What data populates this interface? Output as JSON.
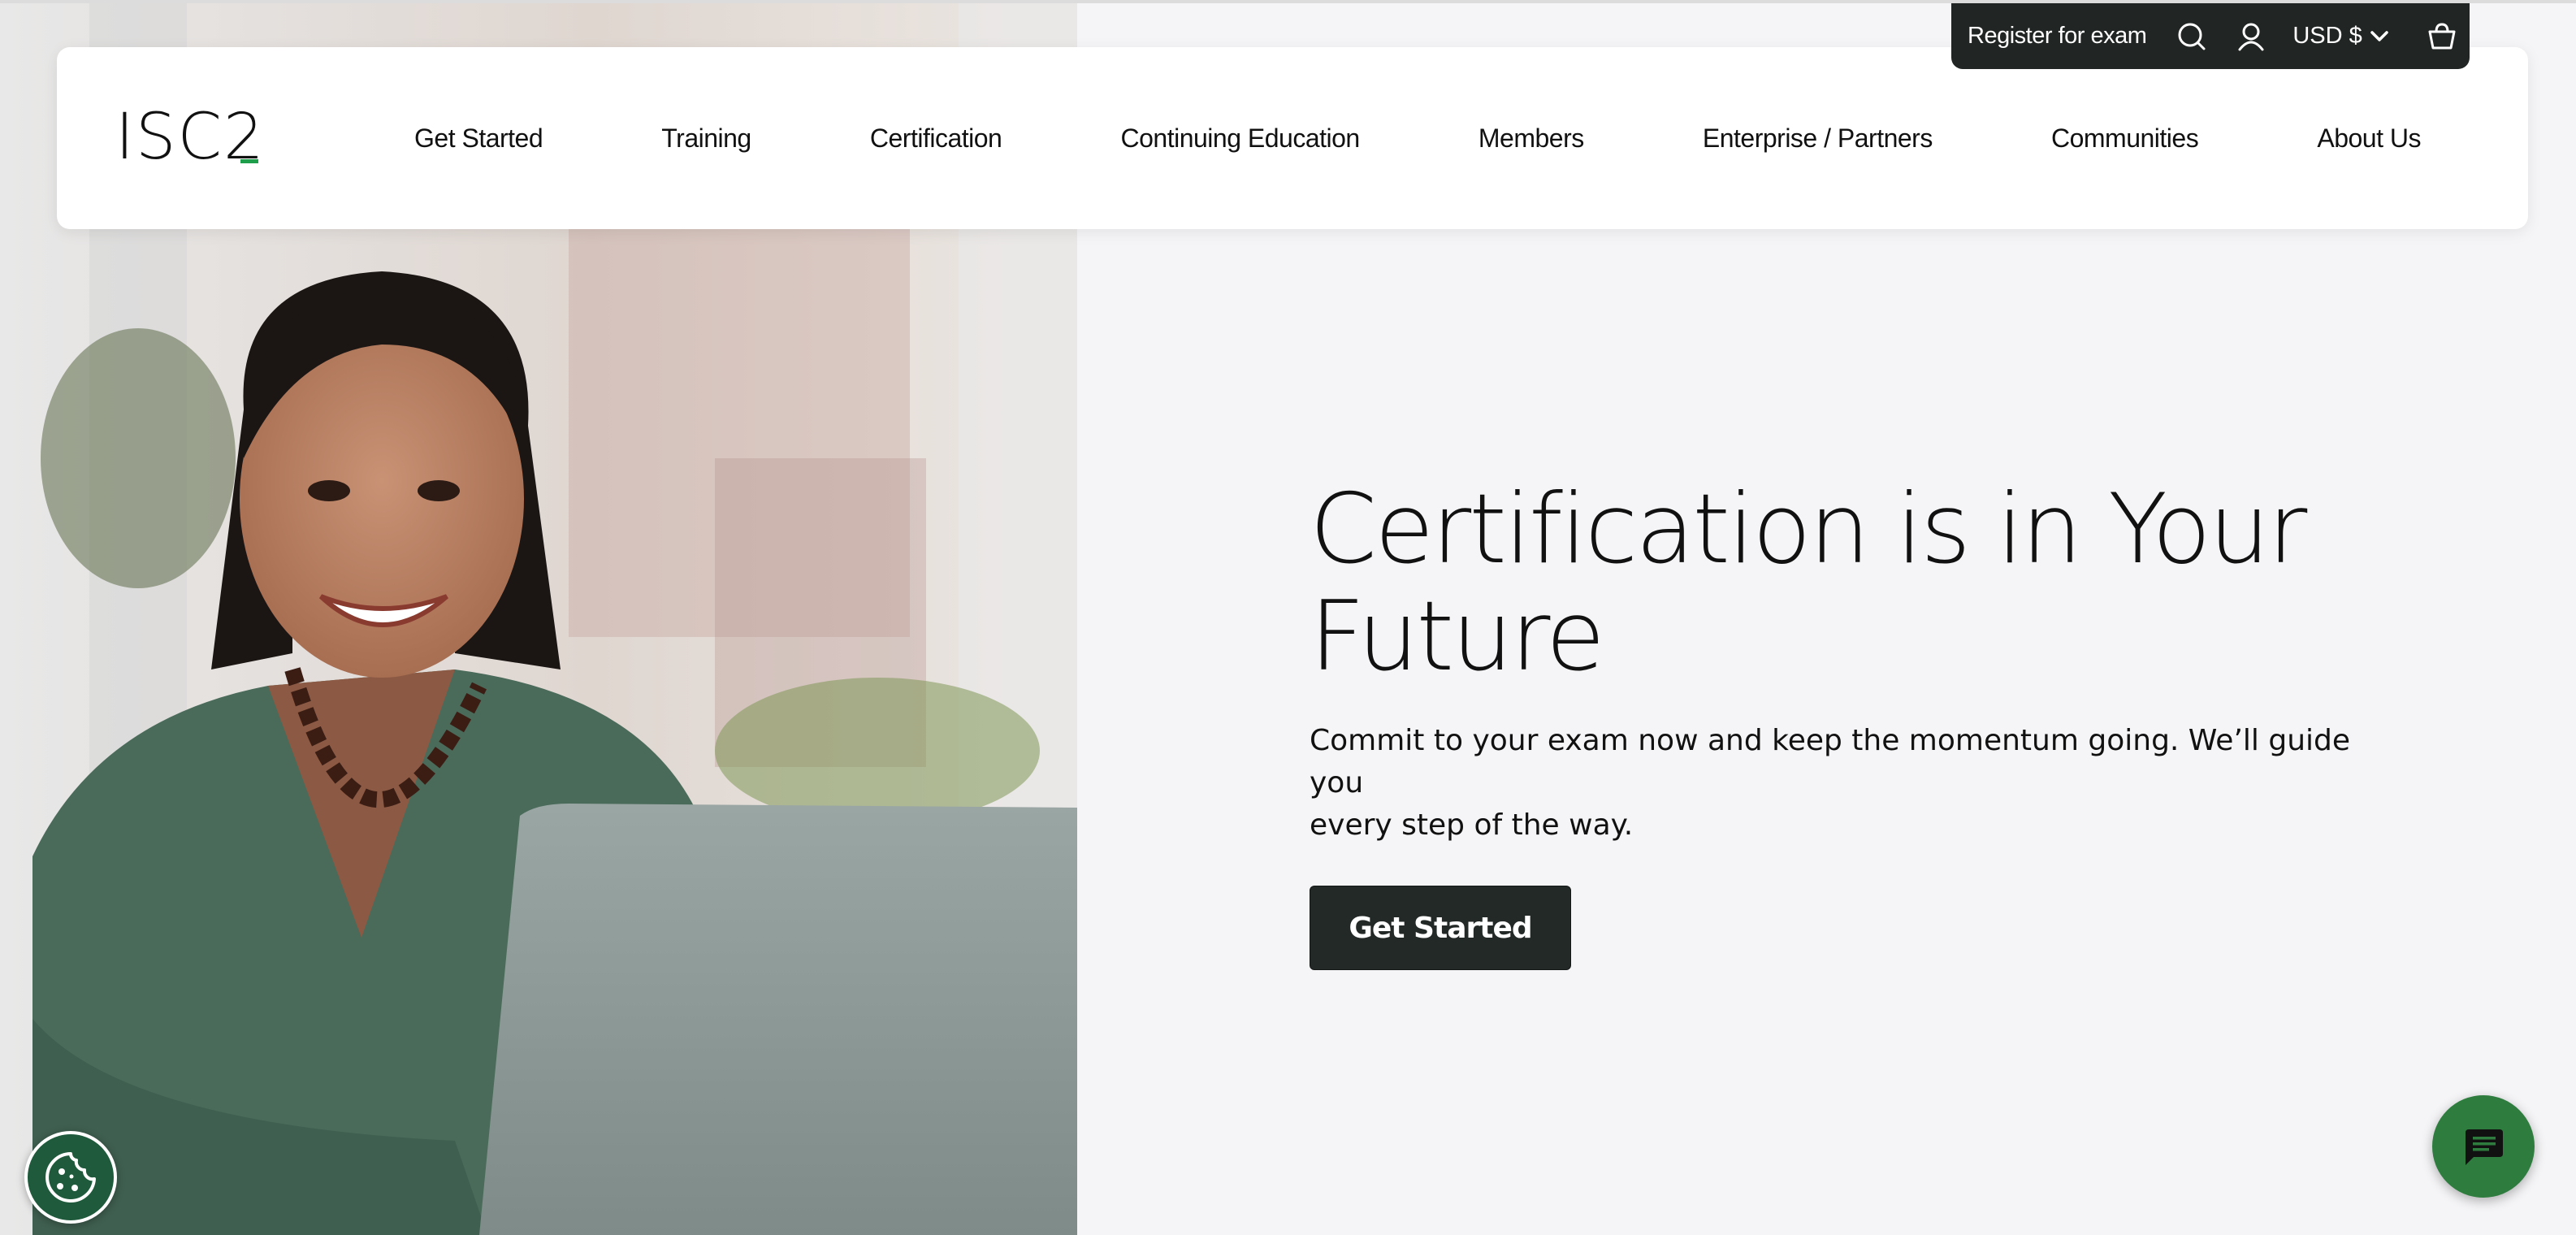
{
  "brand": {
    "logo_text": "ISC2",
    "accent_color": "#1e9e4a",
    "dark_color": "#232926"
  },
  "util_bar": {
    "register_label": "Register for exam",
    "search_icon": "search-icon",
    "account_icon": "user-icon",
    "currency_label": "USD $",
    "cart_icon": "cart-icon"
  },
  "nav": {
    "items": [
      {
        "label": "Get Started"
      },
      {
        "label": "Training"
      },
      {
        "label": "Certification"
      },
      {
        "label": "Continuing Education"
      },
      {
        "label": "Members"
      },
      {
        "label": "Enterprise / Partners"
      },
      {
        "label": "Communities"
      },
      {
        "label": "About Us"
      }
    ]
  },
  "hero": {
    "title_line1": "Certification is in Your",
    "title_line2": "Future",
    "subtitle_line1": "Commit to your exam now and keep the momentum going. We’ll guide you",
    "subtitle_line2": "every step of the way.",
    "cta_label": "Get Started"
  },
  "floating": {
    "cookie_icon": "cookie-icon",
    "chat_icon": "chat-icon"
  }
}
